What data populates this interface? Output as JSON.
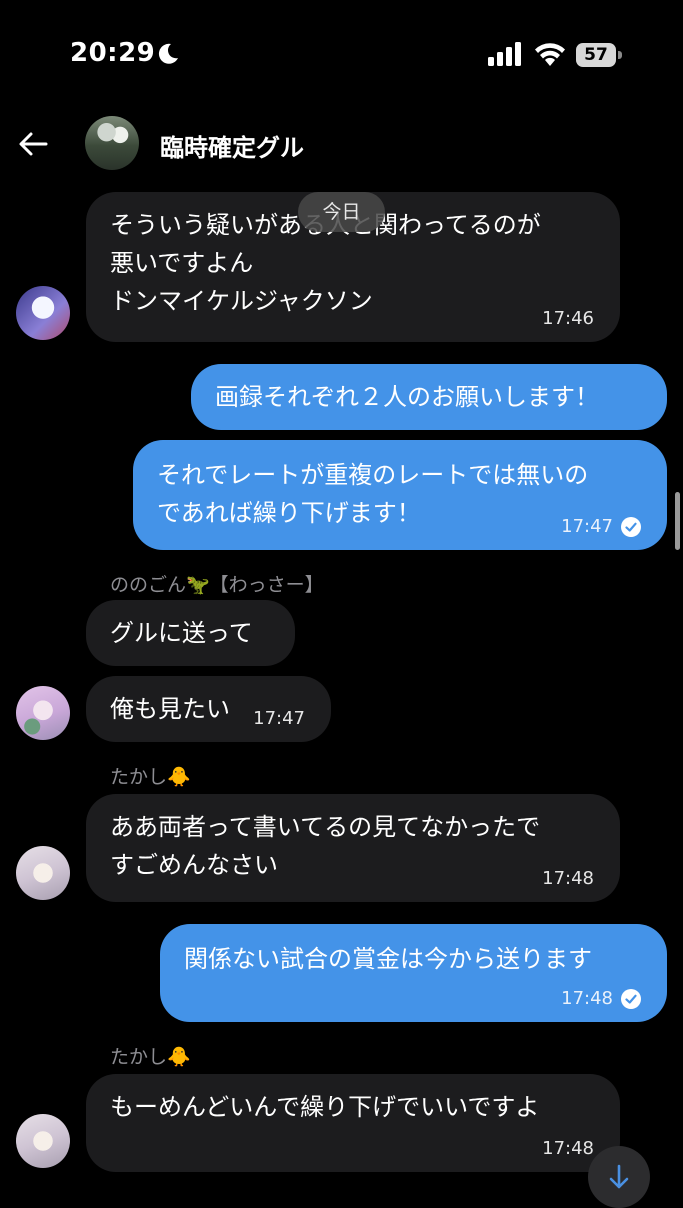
{
  "status_bar": {
    "time": "20:29",
    "battery": "57",
    "icons": [
      "moon-icon",
      "cellular-signal-icon",
      "wifi-icon",
      "battery-icon"
    ]
  },
  "header": {
    "title": "臨時確定グル",
    "back_icon": "arrow-left-icon"
  },
  "date_divider": "今日",
  "messages": [
    {
      "direction": "incoming",
      "text": "そういう疑いがある人と関わってるのが\n悪いですよん\nドンマイケルジャクソン",
      "time": "17:46",
      "avatar": "olaf"
    },
    {
      "direction": "outgoing",
      "text": "画録それぞれ２人のお願いします！"
    },
    {
      "direction": "outgoing",
      "text": "それでレートが重複のレートでは無いの\nであれば繰り下げます！",
      "time": "17:47",
      "read": true
    },
    {
      "direction": "incoming",
      "sender": "ののごん🦖【わっさー】",
      "text": "グルに送って"
    },
    {
      "direction": "incoming",
      "text": "俺も見たい",
      "time": "17:47",
      "avatar": "pink"
    },
    {
      "direction": "incoming",
      "sender": "たかし🐥",
      "text": "ああ両者って書いてるの見てなかったで\nすごめんなさい",
      "time": "17:48",
      "avatar": "girl"
    },
    {
      "direction": "outgoing",
      "text": "関係ない試合の賞金は今から送ります",
      "time": "17:48",
      "read": true
    },
    {
      "direction": "incoming",
      "sender": "たかし🐥",
      "text": "もーめんどいんで繰り下げでいいですよ",
      "time": "17:48",
      "avatar": "girl"
    }
  ],
  "scroll_down_icon": "arrow-down-icon",
  "colors": {
    "outgoing_bubble": "#4493e8",
    "incoming_bubble": "#1c1c1e",
    "background": "#000000"
  }
}
